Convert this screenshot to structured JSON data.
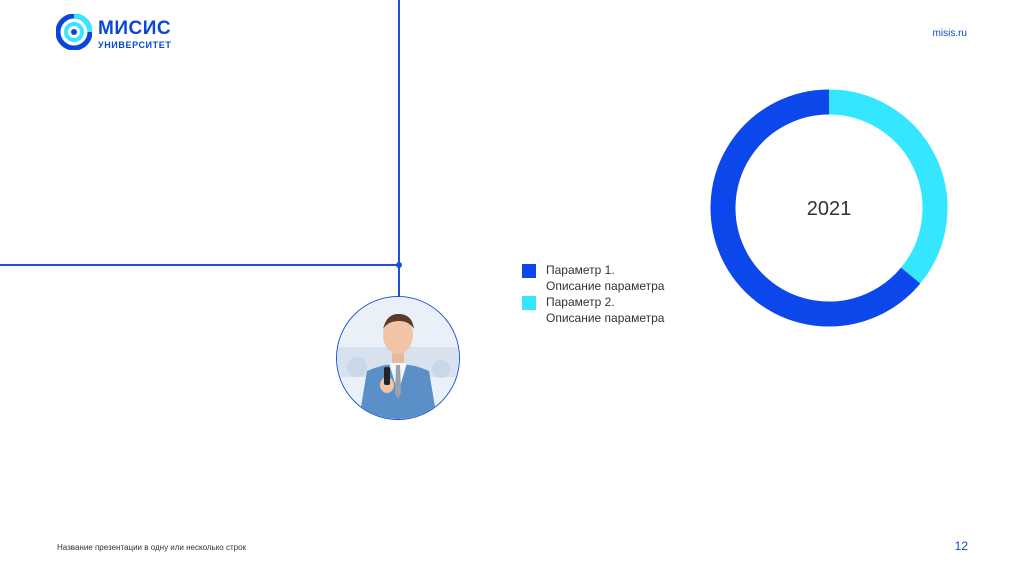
{
  "brand": {
    "name": "МИСИС",
    "subtitle": "УНИВЕРСИТЕТ",
    "site": "misis.ru",
    "primary_color": "#0b47d6",
    "accent_color": "#35e6ff"
  },
  "footer": {
    "presentation_title": "Название презентации в одну или несколько строк",
    "page_number": "12"
  },
  "chart_data": {
    "type": "pie",
    "center_label": "2021",
    "series": [
      {
        "name": "Параметр 1.",
        "description": "Описание параметра",
        "value": 64,
        "color": "#0b47ea"
      },
      {
        "name": "Параметр 2.",
        "description": "Описание параметра",
        "value": 36,
        "color": "#35e6ff"
      }
    ]
  }
}
